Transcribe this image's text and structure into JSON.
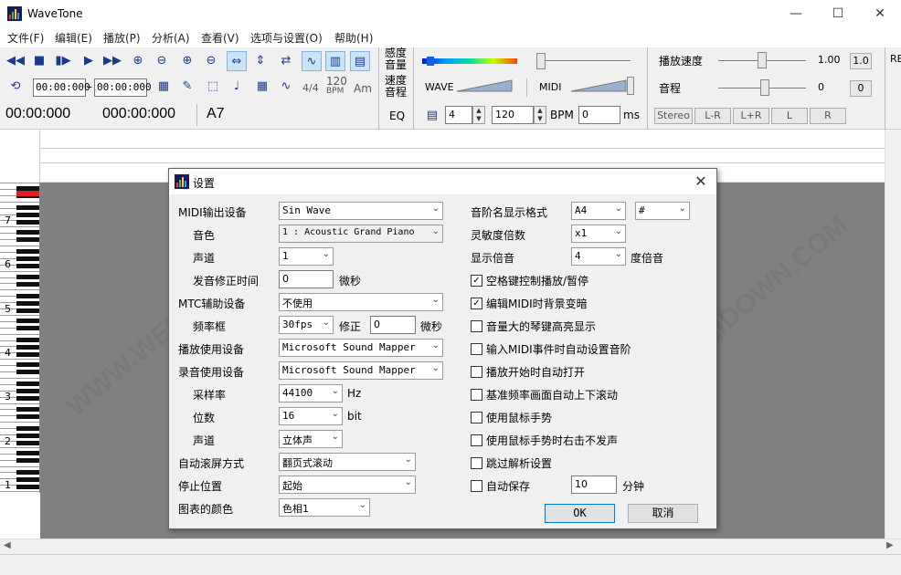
{
  "window": {
    "title": "WaveTone",
    "minimize": "—",
    "maximize": "☐",
    "close": "✕"
  },
  "menu": [
    "文件(F)",
    "编辑(E)",
    "播放(P)",
    "分析(A)",
    "查看(V)",
    "选项与设置(O)",
    "帮助(H)"
  ],
  "toolbar": {
    "time_start": "00:00:000",
    "time_end": "00:00:000",
    "time_display_1": "00:00:000",
    "time_display_2": "000:00:000",
    "note_display": "A7",
    "tempo_4_4": "4/4",
    "bpm_120": "120",
    "bpm_label_small": "BPM",
    "am_label": "Am",
    "sensitivity_label_1": "感度",
    "sensitivity_label_2": "音量",
    "speed_label_1": "速度",
    "speed_label_2": "音程",
    "eq_label": "EQ",
    "wave_label": "WAVE",
    "midi_label": "MIDI",
    "beat_value": "4",
    "bpm_value": "120",
    "bpm_label": "BPM",
    "ms_value": "0",
    "ms_label": "ms",
    "playback_speed_label": "播放速度",
    "playback_speed_value": "1.00",
    "playback_speed_btn": "1.0",
    "pitch_label": "音程",
    "pitch_value": "0",
    "pitch_btn": "0",
    "stereo_label": "Stereo",
    "lr_btn": "L-R",
    "lpr_btn": "L+R",
    "l_btn": "L",
    "r_btn": "R",
    "re_label": "RE"
  },
  "piano": {
    "octaves": [
      "7",
      "6",
      "5",
      "4",
      "3",
      "2",
      "1"
    ]
  },
  "dialog": {
    "title": "设置",
    "close": "✕",
    "left": {
      "midi_output_label": "MIDI输出设备",
      "midi_output_value": "Sin Wave",
      "tone_label": "音色",
      "tone_value": "1 : Acoustic Grand Piano",
      "channel_label": "声道",
      "channel_value": "1",
      "correction_label": "发音修正时间",
      "correction_value": "0",
      "correction_unit": "微秒",
      "mtc_label": "MTC辅助设备",
      "mtc_value": "不使用",
      "framerate_label": "频率框",
      "framerate_value": "30fps",
      "framerate_correction_label": "修正",
      "framerate_correction_value": "0",
      "framerate_correction_unit": "微秒",
      "playback_device_label": "播放使用设备",
      "playback_device_value": "Microsoft Sound Mapper",
      "record_device_label": "录音使用设备",
      "record_device_value": "Microsoft Sound Mapper",
      "samplerate_label": "采样率",
      "samplerate_value": "44100",
      "samplerate_unit": "Hz",
      "bits_label": "位数",
      "bits_value": "16",
      "bits_unit": "bit",
      "rec_channel_label": "声道",
      "rec_channel_value": "立体声",
      "autoscroll_label": "自动滚屏方式",
      "autoscroll_value": "翻页式滚动",
      "stop_pos_label": "停止位置",
      "stop_pos_value": "起始",
      "chart_color_label": "图表的颜色",
      "chart_color_value": "色相1"
    },
    "right": {
      "notename_label": "音阶名显示格式",
      "notename_value": "A4",
      "notename_sharp": "#",
      "sensitivity_label": "灵敏度倍数",
      "sensitivity_value": "x1",
      "octave_label": "显示倍音",
      "octave_value": "4",
      "octave_unit": "度倍音",
      "checks": [
        {
          "label": "空格键控制播放/暂停",
          "checked": true
        },
        {
          "label": "编辑MIDI时背景变暗",
          "checked": true
        },
        {
          "label": "音量大的琴键高亮显示",
          "checked": false
        },
        {
          "label": "输入MIDI事件时自动设置音阶",
          "checked": false
        },
        {
          "label": "播放开始时自动打开",
          "checked": false
        },
        {
          "label": "基准频率画面自动上下滚动",
          "checked": false
        },
        {
          "label": "使用鼠标手势",
          "checked": false
        },
        {
          "label": "使用鼠标手势时右击不发声",
          "checked": false
        },
        {
          "label": "跳过解析设置",
          "checked": false
        },
        {
          "label": "自动保存",
          "checked": false
        }
      ],
      "autosave_value": "10",
      "autosave_unit": "分钟",
      "ok": "OK",
      "cancel": "取消"
    },
    "check_mark": "✓"
  },
  "watermark": "WWW.WEIDOWN.COM",
  "colors": {
    "accent": "#0078d7",
    "keyhighlight": "#e02020"
  }
}
